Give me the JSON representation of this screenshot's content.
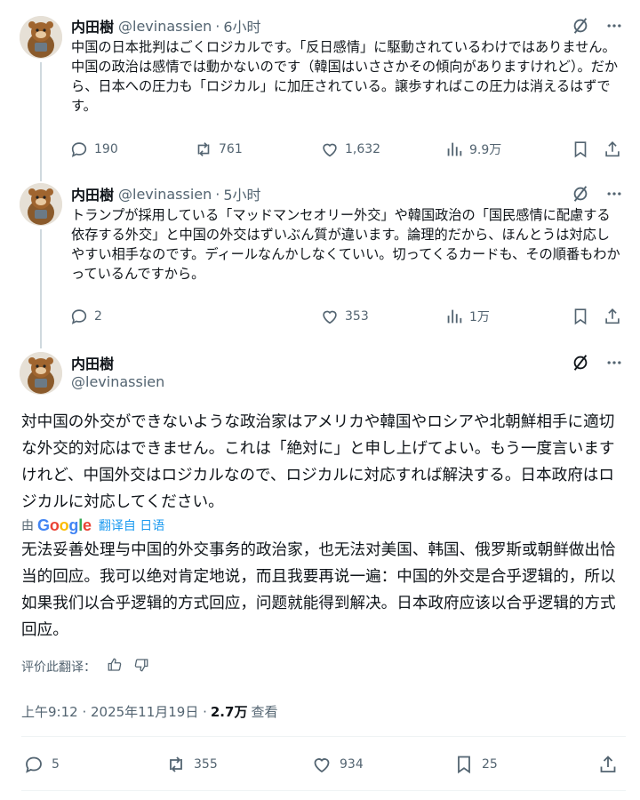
{
  "tweets": [
    {
      "name": "内田樹",
      "handle": "@levinassien",
      "separator": "·",
      "time": "6小时",
      "text": "中国の日本批判はごくロジカルです。「反日感情」に駆動されているわけではありません。中国の政治は感情では動かないのです（韓国はいささかその傾向がありますけれど）。だから、日本への圧力も「ロジカル」に加圧されている。譲歩すればこの圧力は消えるはずです。",
      "replies": "190",
      "reposts": "761",
      "likes": "1,632",
      "views": "9.9万"
    },
    {
      "name": "内田樹",
      "handle": "@levinassien",
      "separator": "·",
      "time": "5小时",
      "text": "トランプが採用している「マッドマンセオリー外交」や韓国政治の「国民感情に配慮する依存する外交」と中国の外交はずいぶん質が違います。論理的だから、ほんとうは対応しやすい相手なのです。ディールなんかしなくていい。切ってくるカードも、その順番もわかっているんですから。",
      "replies": "2",
      "likes": "353",
      "views": "1万"
    }
  ],
  "main": {
    "name": "内田樹",
    "handle": "@levinassien",
    "original_text": "対中国の外交ができないような政治家はアメリカや韓国やロシアや北朝鮮相手に適切な外交的対応はできません。これは「絶対に」と申し上げてよい。もう一度言いますけれど、中国外交はロジカルなので、ロジカルに対応すれば解決する。日本政府はロジカルに対応してください。",
    "translated_by_prefix": "由",
    "google": {
      "letters": [
        "G",
        "o",
        "o",
        "g",
        "l",
        "e"
      ],
      "colors": [
        "#4285F4",
        "#EA4335",
        "#FBBC05",
        "#4285F4",
        "#34A853",
        "#EA4335"
      ]
    },
    "translated_from": "翻译自 日语",
    "translated_text": "无法妥善处理与中国的外交事务的政治家，也无法对美国、韩国、俄罗斯或朝鲜做出恰当的回应。我可以绝对肯定地说，而且我要再说一遍：中国的外交是合乎逻辑的，所以如果我们以合乎逻辑的方式回应，问题就能得到解决。日本政府应该以合乎逻辑的方式回应。",
    "rate_label": "评价此翻译：",
    "timestamp": "上午9:12 · 2025年11月19日 ·",
    "views_count": "2.7万",
    "views_label": "查看",
    "replies": "5",
    "reposts": "355",
    "likes": "934",
    "bookmarks": "25"
  },
  "colors": {
    "text": "#0f1419",
    "secondary": "#536471",
    "link": "#1d9bf0",
    "thread_line": "#cfd9de"
  },
  "icons": [
    "grok-icon",
    "more-icon",
    "reply-icon",
    "repost-icon",
    "like-icon",
    "views-icon",
    "bookmark-icon",
    "share-icon",
    "thumbs-up-icon",
    "thumbs-down-icon"
  ]
}
